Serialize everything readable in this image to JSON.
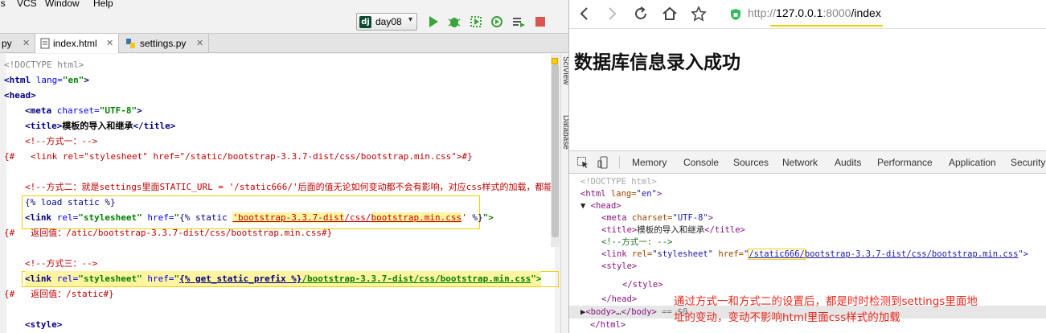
{
  "ide": {
    "menu": [
      "ls",
      "VCS",
      "Window",
      "Help"
    ],
    "run_config": {
      "badge": "dj",
      "label": "day08"
    },
    "tabs": [
      {
        "label": "py",
        "closable": true
      },
      {
        "label": "index.html",
        "closable": true,
        "active": true
      },
      {
        "label": "settings.py",
        "closable": true
      }
    ],
    "side_labels": [
      "SciView",
      "Database"
    ],
    "code": {
      "l1": "<!DOCTYPE html>",
      "l2_tag": "<html",
      "l2_attr": " lang=",
      "l2_val": "\"en\"",
      "l2_end": ">",
      "l3": "<head>",
      "l4_tag": "<meta",
      "l4_attr": " charset=",
      "l4_val": "\"UTF-8\"",
      "l4_end": ">",
      "l5_open": "<title>",
      "l5_text": "模板的导入和继承",
      "l5_close": "</title>",
      "l6": "<!--方式一：-->",
      "l7_prefix": "{#",
      "l7_body": "<link rel=\"stylesheet\" href=\"/static/bootstrap-3.3.7-dist/css/bootstrap.min.css\">#}",
      "l9": "<!--方式二：就是settings里面STATIC_URL = '/static666/'后面的值无论如何变动都不会有影响，对应css样式的加载，都能",
      "l10_tpl": "{% load static %}",
      "l11_tag": "<link",
      "l11_attr1": " rel=",
      "l11_val1": "\"stylesheet\"",
      "l11_attr2": " href=",
      "l11_q": "\"",
      "l11_tpl_open": "{% static ",
      "l11_path_a": "'bootstrap-3.3.7-dist",
      "l11_path_b": "/css/",
      "l11_path_c": "bootstrap.min.css",
      "l11_path_d": "'",
      "l11_tpl_close": " %}",
      "l11_end": "\">",
      "l12_prefix": "{#",
      "l12_body": "返回值：/atic/bootstrap-3.3.7-dist/css/bootstrap.min.css#}",
      "l14": "<!--方式三：-->",
      "l15_tag": "<link",
      "l15_attr1": " rel=",
      "l15_val1": "\"stylesheet\"",
      "l15_attr2": " href=",
      "l15_q": "\"",
      "l15_tpl": "{% get_static_prefix %}",
      "l15_path": "/bootstrap-3.3.7-dist/css/bootstrap.min.css",
      "l15_end": "\">",
      "l16_prefix": "{#",
      "l16_body": "返回值：/static#}",
      "l18": "<style>"
    }
  },
  "browser": {
    "url_prefix": "http://",
    "url_host": "127.0.0.1",
    "url_port": ":8000",
    "url_path": "/index",
    "page_heading": "数据库信息录入成功",
    "devtools": {
      "tabs": [
        "Memory",
        "Console",
        "Sources",
        "Network",
        "Audits",
        "Performance",
        "Application",
        "Security"
      ],
      "dom": {
        "d1": "<!DOCTYPE html>",
        "d2_open": "<html",
        "d2_attr": " lang=",
        "d2_val": "\"en\"",
        "d2_end": ">",
        "d3_arrow": "▼",
        "d3": "<head>",
        "d4_open": "<meta",
        "d4_attr": " charset=",
        "d4_val": "\"UTF-8\"",
        "d4_end": ">",
        "d5_open": "<title>",
        "d5_text": "模板的导入和继承",
        "d5_close": "</title>",
        "d6": "<!--方式一: -->",
        "d7_open": "<link",
        "d7_attr1": " rel=",
        "d7_val1": "\"stylesheet\"",
        "d7_attr2": " href=",
        "d7_q1": "\"",
        "d7_link_a": "/static666/",
        "d7_link_b": "bootstrap-3.3.7-dist/css/bootstrap.min.css",
        "d7_q2": "\">",
        "d8": "<style>",
        "d9": "</style>",
        "d10": "</head>",
        "d11_arrow": "▶",
        "d11_open": "<body>",
        "d11_dots": "…",
        "d11_close": "</body>",
        "d11_eq": " == $0",
        "d12": "</html>"
      },
      "annotation_line1": "通过方式一和方式二的设置后，都是时时检测到settings里面地",
      "annotation_line2": "址的变动，变动不影响html里面css样式的加载"
    }
  }
}
